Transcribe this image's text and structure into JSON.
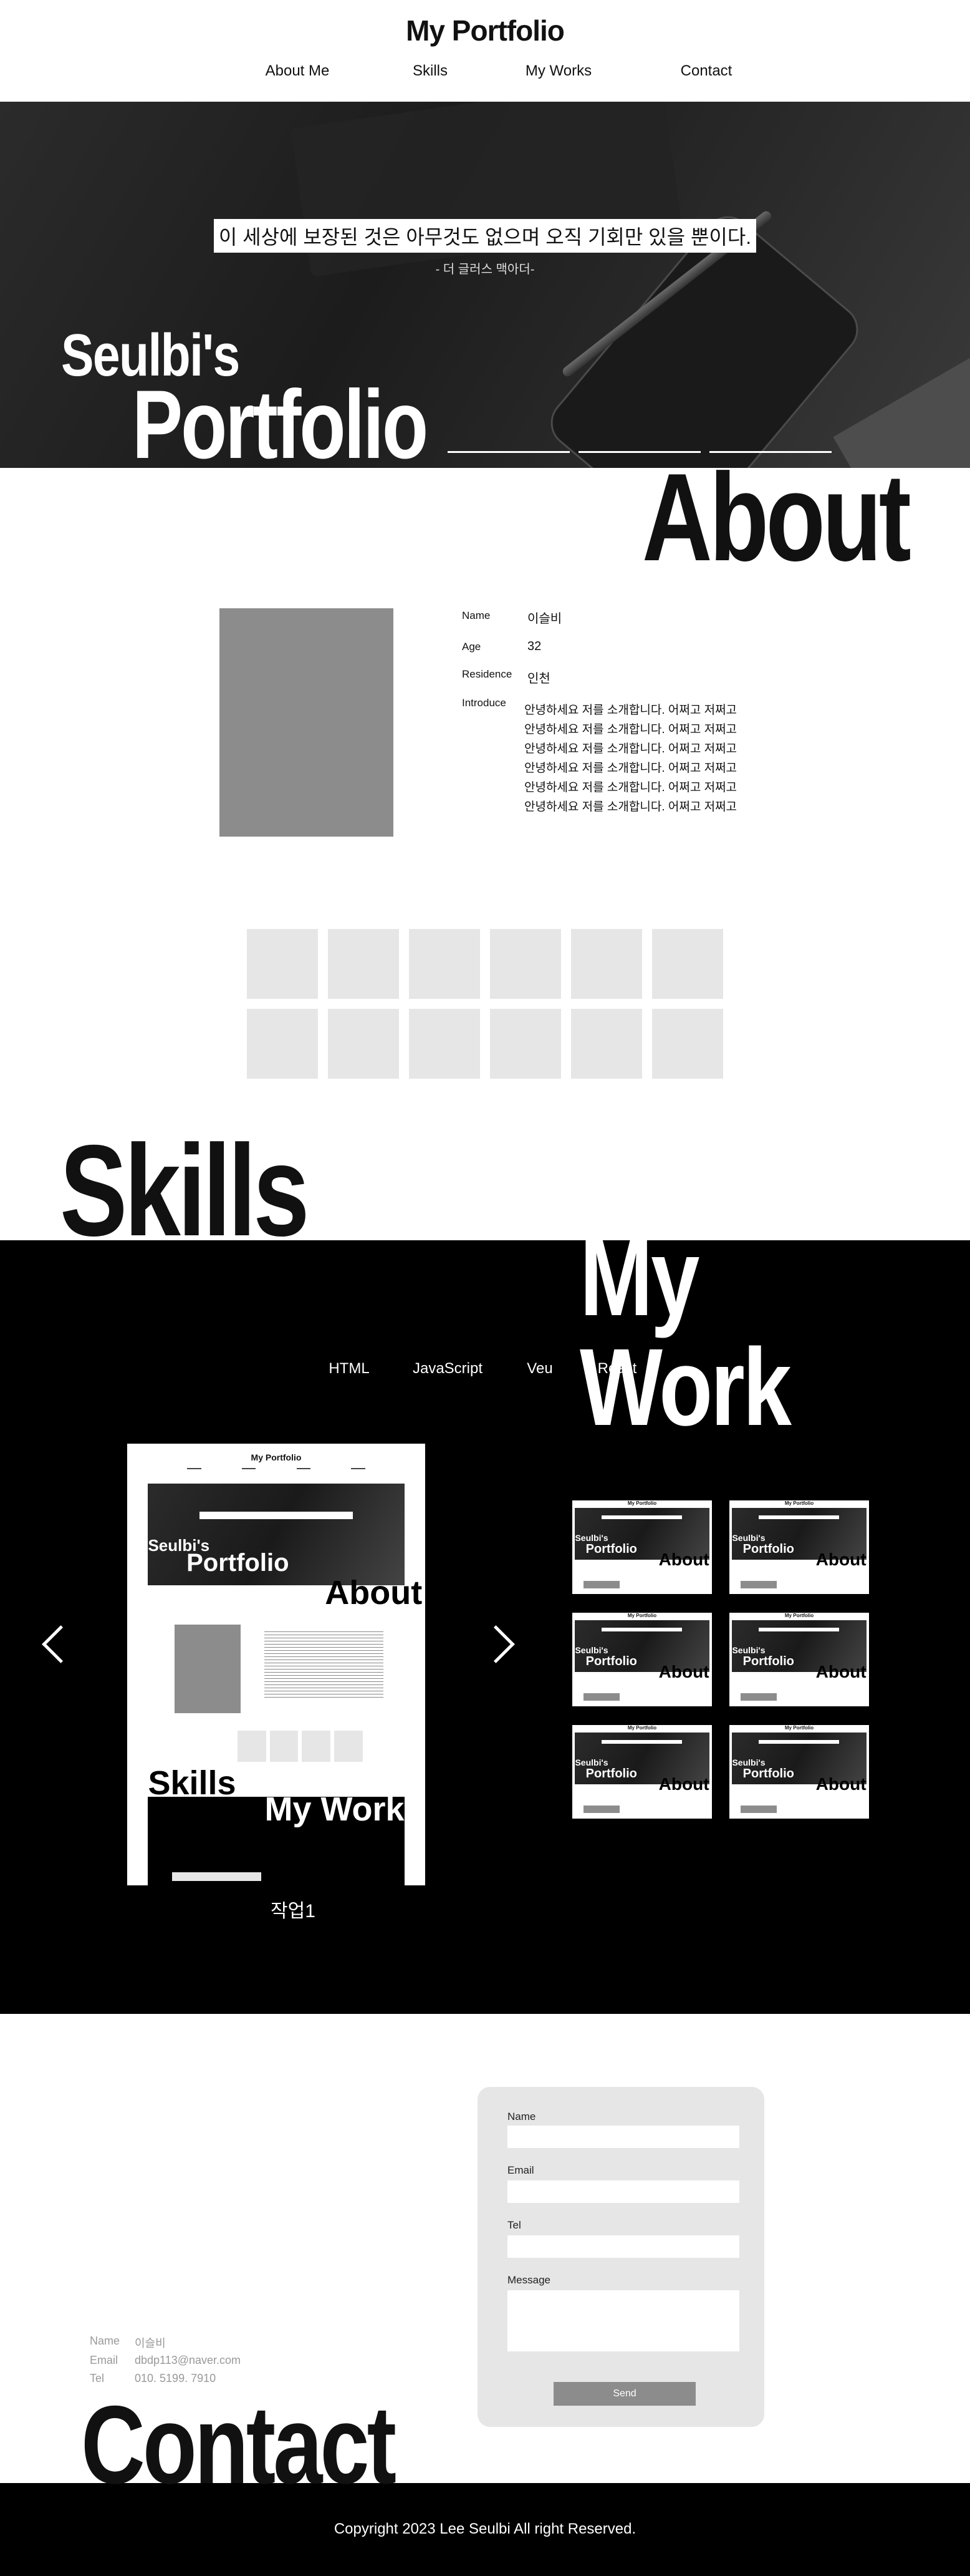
{
  "header": {
    "brand": "My Portfolio",
    "nav": [
      "About Me",
      "Skills",
      "My Works",
      "Contact"
    ]
  },
  "hero": {
    "quote": "이 세상에 보장된 것은 아무것도 없으며 오직 기회만 있을 뿐이다.",
    "author": "- 더 글러스 맥아더-",
    "title_small": "Seulbi's",
    "title_large": "Portfolio"
  },
  "about": {
    "title": "About",
    "fields": [
      {
        "label": "Name",
        "value": "이슬비"
      },
      {
        "label": "Age",
        "value": "32"
      },
      {
        "label": "Residence",
        "value": "인천"
      }
    ],
    "intro_label": "Introduce",
    "intro_lines": [
      "안녕하세요 저를 소개합니다. 어쩌고 저쩌고",
      "안녕하세요 저를 소개합니다. 어쩌고 저쩌고",
      "안녕하세요 저를 소개합니다. 어쩌고 저쩌고",
      "안녕하세요 저를 소개합니다. 어쩌고 저쩌고",
      "안녕하세요 저를 소개합니다. 어쩌고 저쩌고",
      "안녕하세요 저를 소개합니다. 어쩌고 저쩌고"
    ]
  },
  "skills": {
    "title": "Skills",
    "tile_count": 12
  },
  "work": {
    "title": "My Work",
    "tabs": [
      "HTML",
      "JavaScript",
      "Veu",
      "React"
    ],
    "caption": "작업1",
    "preview": {
      "brand": "My Portfolio",
      "title_small": "Seulbi's",
      "title_large": "Portfolio",
      "about": "About",
      "skills": "Skills",
      "work": "My Work"
    },
    "thumb_count": 6
  },
  "contact": {
    "title": "Contact",
    "form": {
      "name_label": "Name",
      "email_label": "Email",
      "tel_label": "Tel",
      "message_label": "Message",
      "send_label": "Send"
    },
    "info": [
      {
        "label": "Name",
        "value": "이슬비"
      },
      {
        "label": "Email",
        "value": "dbdp113@naver.com"
      },
      {
        "label": "Tel",
        "value": "010. 5199. 7910"
      }
    ]
  },
  "footer": {
    "copyright": "Copyright 2023 Lee Seulbi All right Reserved."
  },
  "colors": {
    "black": "#000000",
    "gray_tile": "#e6e6e6",
    "photo_gray": "#8c8c8c"
  }
}
